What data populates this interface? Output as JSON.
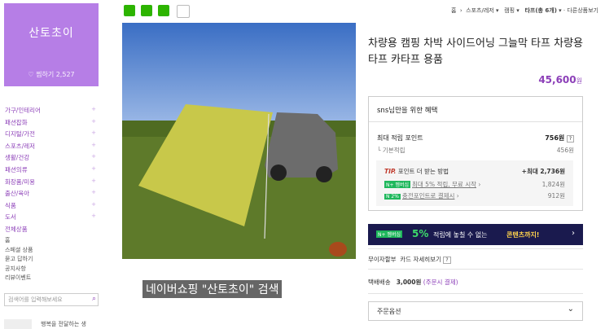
{
  "store": {
    "name": "산토초이",
    "likes": "찜하기 2,527"
  },
  "categories": [
    "가구/인테리어",
    "패션잡화",
    "디지털/가전",
    "스포츠/레저",
    "생활/건강",
    "패션의류",
    "화장품/미용",
    "출산/육아",
    "식품",
    "도서",
    "전체상품"
  ],
  "links": [
    "홈",
    "스페셜 상품",
    "묻고 답하기",
    "공지사항",
    "리뷰이벤트"
  ],
  "search": {
    "placeholder": "검색어를 입력해보세요"
  },
  "promo": {
    "text": "행복을 전달하는 생"
  },
  "breadcrumb": {
    "home": "홈",
    "cat1": "스포츠/레저",
    "cat2": "캠핑",
    "cat3": "타프(총 6개)",
    "other": "다른상품보기"
  },
  "share_icons": [
    "blog-icon",
    "cafe-icon",
    "band-icon",
    "share-icon"
  ],
  "product": {
    "title": "차량용 캠핑 차박 사이드어닝 그늘막 타프 차량용타프 카타프 용품",
    "price": "45,600",
    "price_unit": "원",
    "image_banner": "네이버쇼핑 \"산토초이\" 검색"
  },
  "benefit": {
    "title": "sns님만을 위한 혜택",
    "max_points_label": "최대 적립 포인트",
    "max_points": "756원",
    "basic_label": "기본적립",
    "basic_value": "456원",
    "tip_label": "TIP.",
    "tip_text": "포인트 더 받는 방법",
    "tip_max": "+최대 2,736원",
    "item1_label": "최대 5% 적립, 무료 시작",
    "item1_value": "1,824원",
    "item2_label": "충전포인트로 결제시",
    "item2_value": "912원",
    "badge1": "N+ 멤버십",
    "badge2": "N 2%"
  },
  "ad": {
    "badge": "N+ 멤버십",
    "pct": "5%",
    "text": "적립에 놓칠 수 없는",
    "highlight": "콘텐츠까지!"
  },
  "interest": {
    "label": "무이자할부",
    "value": "카드 자세히보기"
  },
  "shipping": {
    "label": "택배배송",
    "value": "3,000원",
    "note": "(주문시 결제)"
  },
  "option": {
    "label": "주문옵션"
  },
  "colors": {
    "brand": "#b67ee6",
    "accent": "#8c3fb8",
    "ad": "#1a1a4e"
  }
}
